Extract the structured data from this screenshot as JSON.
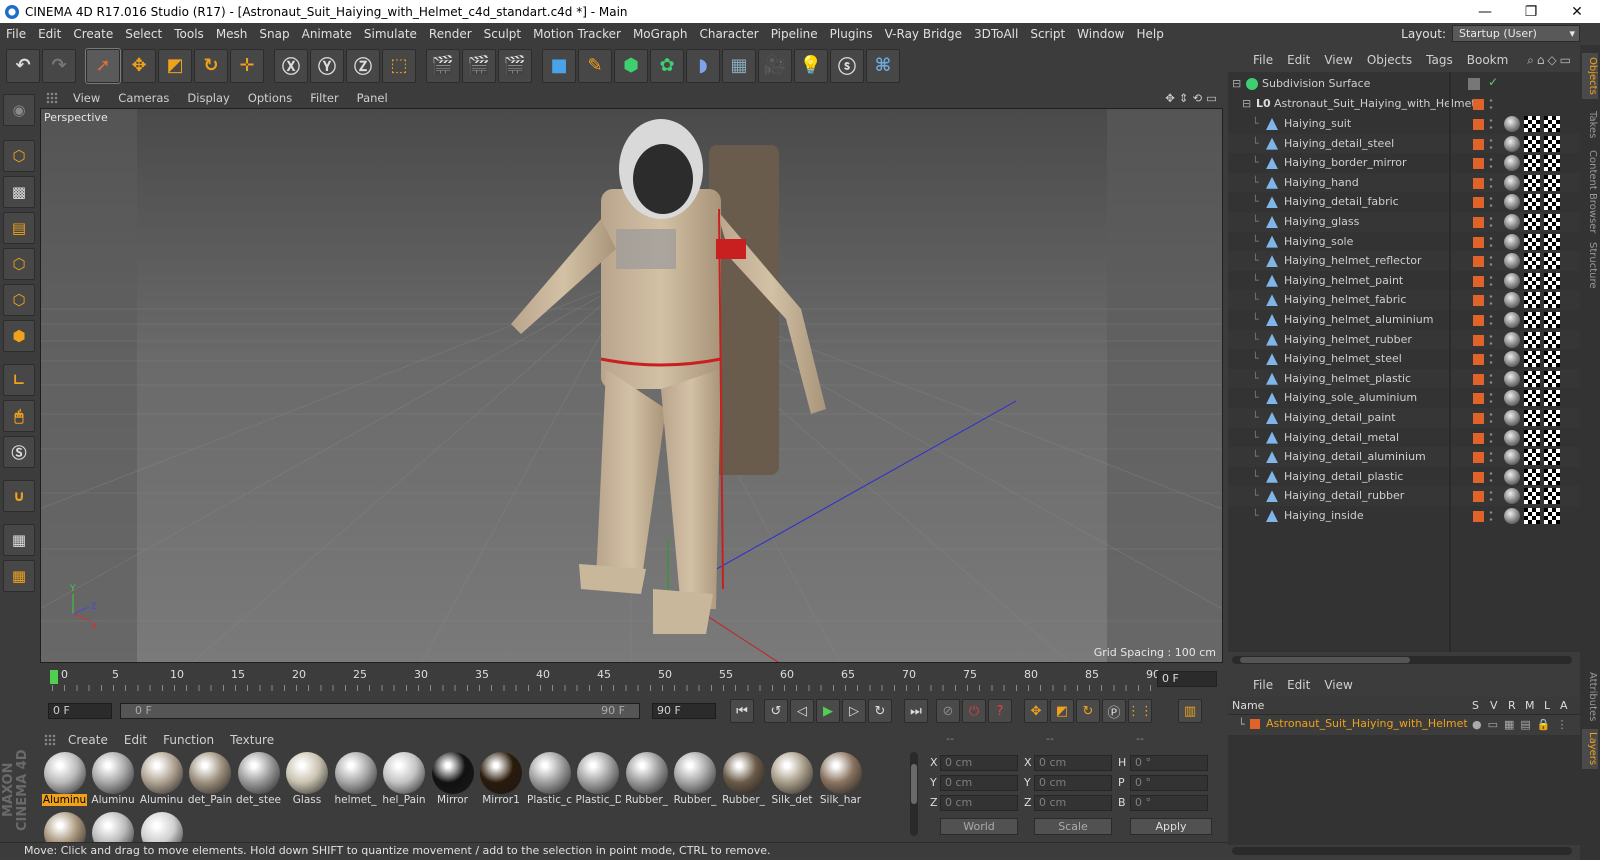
{
  "window": {
    "title": "CINEMA 4D R17.016 Studio (R17) - [Astronaut_Suit_Haiying_with_Helmet_c4d_standart.c4d *] - Main",
    "controls": [
      "—",
      "❐",
      "✕"
    ]
  },
  "menubar": [
    "File",
    "Edit",
    "Create",
    "Select",
    "Tools",
    "Mesh",
    "Snap",
    "Animate",
    "Simulate",
    "Render",
    "Sculpt",
    "Motion Tracker",
    "MoGraph",
    "Character",
    "Pipeline",
    "Plugins",
    "V-Ray Bridge",
    "3DToAll",
    "Script",
    "Window",
    "Help"
  ],
  "layout": {
    "label": "Layout:",
    "value": "Startup (User)"
  },
  "viewport": {
    "menu": [
      "View",
      "Cameras",
      "Display",
      "Options",
      "Filter",
      "Panel"
    ],
    "label": "Perspective",
    "grid_spacing": "Grid Spacing : 100 cm",
    "axis": {
      "x": "X",
      "y": "Y",
      "z": "Z"
    }
  },
  "timeline": {
    "ticks": [
      "0",
      "5",
      "10",
      "15",
      "20",
      "25",
      "30",
      "35",
      "40",
      "45",
      "50",
      "55",
      "60",
      "65",
      "70",
      "75",
      "80",
      "85",
      "90"
    ],
    "current_frame": "0 F",
    "start_field": "0 F",
    "slider_start": "0 F",
    "slider_end": "90 F",
    "end_field": "90 F"
  },
  "materials": {
    "menu": [
      "Create",
      "Edit",
      "Function",
      "Texture"
    ],
    "items": [
      {
        "label": "Aluminu",
        "selected": true,
        "color": "#b9b9b9"
      },
      {
        "label": "Aluminu",
        "color": "#a8a8a8"
      },
      {
        "label": "Aluminu",
        "color": "#b0a392"
      },
      {
        "label": "det_Pain",
        "color": "#9c8f7d"
      },
      {
        "label": "det_stee",
        "color": "#9a9a9a"
      },
      {
        "label": "Glass",
        "color": "#c9c2b0"
      },
      {
        "label": "helmet_",
        "color": "#a7a7a7"
      },
      {
        "label": "hel_Pain",
        "color": "#c3c3c3"
      },
      {
        "label": "Mirror",
        "color": "#111111"
      },
      {
        "label": "Mirror1",
        "color": "#2a1a0a"
      },
      {
        "label": "Plastic_c",
        "color": "#9e9e9e"
      },
      {
        "label": "Plastic_D",
        "color": "#a2a2a2"
      },
      {
        "label": "Rubber_",
        "color": "#9a9a9a"
      },
      {
        "label": "Rubber_",
        "color": "#a5a5a5"
      },
      {
        "label": "Rubber_",
        "color": "#6a5a48"
      },
      {
        "label": "Silk_det",
        "color": "#a89c88"
      },
      {
        "label": "Silk_har",
        "color": "#8a7360"
      },
      {
        "label": "",
        "color": "#a8957b"
      },
      {
        "label": "",
        "color": "#bbbbbb"
      },
      {
        "label": "",
        "color": "#cfcfcf"
      }
    ]
  },
  "coords": {
    "headers": [
      "--",
      "--",
      "--"
    ],
    "rows": [
      {
        "a": "X",
        "av": "0 cm",
        "b": "X",
        "bv": "0 cm",
        "c": "H",
        "cv": "0 °"
      },
      {
        "a": "Y",
        "av": "0 cm",
        "b": "Y",
        "bv": "0 cm",
        "c": "P",
        "cv": "0 °"
      },
      {
        "a": "Z",
        "av": "0 cm",
        "b": "Z",
        "bv": "0 cm",
        "c": "B",
        "cv": "0 °"
      }
    ],
    "space": "World",
    "mode": "Scale",
    "apply": "Apply"
  },
  "status": "Move: Click and drag to move elements. Hold down SHIFT to quantize movement / add to the selection in point mode, CTRL to remove.",
  "brand": "MAXON CINEMA 4D",
  "objects": {
    "menu": [
      "File",
      "Edit",
      "View",
      "Objects",
      "Tags",
      "Bookm"
    ],
    "root": "Subdivision Surface",
    "group": "Astronaut_Suit_Haiying_with_Helmet",
    "items": [
      "Haiying_suit",
      "Haiying_detail_steel",
      "Haiying_border_mirror",
      "Haiying_hand",
      "Haiying_detail_fabric",
      "Haiying_glass",
      "Haiying_sole",
      "Haiying_helmet_reflector",
      "Haiying_helmet_paint",
      "Haiying_helmet_fabric",
      "Haiying_helmet_aluminium",
      "Haiying_helmet_rubber",
      "Haiying_helmet_steel",
      "Haiying_helmet_plastic",
      "Haiying_sole_aluminium",
      "Haiying_detail_paint",
      "Haiying_detail_metal",
      "Haiying_detail_aluminium",
      "Haiying_detail_plastic",
      "Haiying_detail_rubber",
      "Haiying_inside"
    ]
  },
  "layers": {
    "menu": [
      "File",
      "Edit",
      "View"
    ],
    "header": {
      "name": "Name",
      "cols": [
        "S",
        "V",
        "R",
        "M",
        "L",
        "A"
      ]
    },
    "row": "Astronaut_Suit_Haiying_with_Helmet"
  },
  "sidetabs": {
    "top": [
      "Objects",
      "Takes",
      "Content Browser",
      "Structure"
    ],
    "bottom": [
      "Attributes",
      "Layers"
    ]
  }
}
